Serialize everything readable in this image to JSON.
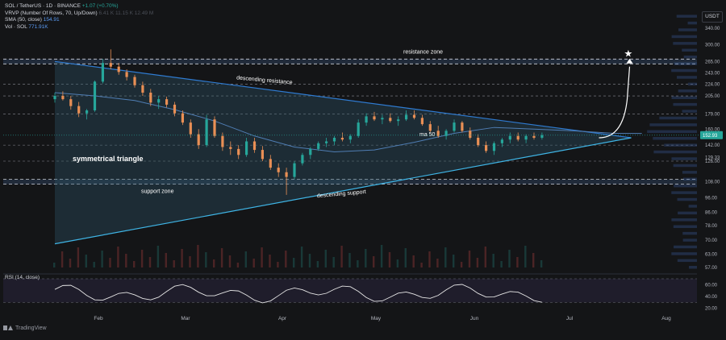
{
  "header": {
    "symbol": "SOL / TetherUS · 1D · BINANCE",
    "change": "+1.07 (+0.70%)",
    "vrvp_label": "VRVP (Number Of Rows, 70, Up/Down)",
    "vrvp_values": "6.41 K   11.15 K   12.49 M",
    "sma_label": "SMA (50, close)",
    "sma_value": "154.91",
    "vol_label": "Vol · SOL",
    "vol_value": "771.91K",
    "currency": "USDT"
  },
  "rsi": {
    "label": "RSI (14, close)",
    "ticks": [
      "60.00",
      "40.00",
      "20.00"
    ]
  },
  "footer": {
    "brand": "TradingView"
  },
  "chart_data": {
    "type": "candlestick",
    "y_scale": "log",
    "ylim": [
      57,
      390
    ],
    "price_ticks": [
      380,
      340,
      300,
      265,
      243,
      224,
      205,
      179,
      160,
      152.93,
      142,
      129.33,
      126,
      108,
      96,
      86,
      78,
      70,
      63,
      57
    ],
    "time_labels": [
      "Feb",
      "Mar",
      "Apr",
      "May",
      "Jun",
      "Jul",
      "Aug"
    ],
    "last_price": 152.93,
    "annotations": {
      "resistance_zone": "resistance zone",
      "support_zone": "support zone",
      "descending_resistance": "descending resistance",
      "descending_support": "descending support",
      "pattern": "symmetrical triangle",
      "ma": "ma 50"
    },
    "levels": {
      "resistance_zone": 265,
      "support_zone": 108,
      "lines": [
        224,
        205,
        179,
        142,
        126
      ]
    },
    "triangle": {
      "upper": [
        [
          0,
          265
        ],
        [
          110,
          150
        ]
      ],
      "lower": [
        [
          0,
          68
        ],
        [
          110,
          150
        ]
      ]
    },
    "sma50": [
      [
        0,
        210
      ],
      [
        10,
        205
      ],
      [
        20,
        198
      ],
      [
        30,
        185
      ],
      [
        40,
        170
      ],
      [
        50,
        152
      ],
      [
        60,
        140
      ],
      [
        70,
        135
      ],
      [
        80,
        137
      ],
      [
        90,
        145
      ],
      [
        100,
        155
      ],
      [
        110,
        162
      ],
      [
        120,
        160
      ],
      [
        130,
        158
      ],
      [
        140,
        155
      ],
      [
        147,
        154.9
      ]
    ],
    "candles": [
      [
        0,
        200,
        210,
        195,
        205
      ],
      [
        2,
        205,
        212,
        198,
        200
      ],
      [
        4,
        200,
        205,
        185,
        190
      ],
      [
        6,
        190,
        196,
        175,
        180
      ],
      [
        8,
        180,
        186,
        172,
        184
      ],
      [
        10,
        184,
        230,
        182,
        228
      ],
      [
        12,
        228,
        270,
        225,
        262
      ],
      [
        14,
        262,
        290,
        250,
        255
      ],
      [
        16,
        255,
        262,
        240,
        245
      ],
      [
        18,
        245,
        250,
        230,
        236
      ],
      [
        20,
        236,
        240,
        218,
        222
      ],
      [
        22,
        222,
        228,
        205,
        210
      ],
      [
        24,
        210,
        216,
        190,
        195
      ],
      [
        26,
        195,
        205,
        186,
        200
      ],
      [
        28,
        200,
        204,
        188,
        192
      ],
      [
        30,
        192,
        196,
        176,
        180
      ],
      [
        32,
        180,
        184,
        165,
        168
      ],
      [
        34,
        168,
        172,
        150,
        154
      ],
      [
        36,
        154,
        160,
        138,
        142
      ],
      [
        38,
        142,
        178,
        140,
        172
      ],
      [
        40,
        172,
        176,
        150,
        152
      ],
      [
        42,
        152,
        156,
        136,
        140
      ],
      [
        44,
        140,
        146,
        132,
        138
      ],
      [
        46,
        138,
        142,
        128,
        132
      ],
      [
        48,
        132,
        150,
        130,
        146
      ],
      [
        50,
        146,
        150,
        134,
        137
      ],
      [
        52,
        137,
        141,
        126,
        128
      ],
      [
        54,
        128,
        132,
        118,
        120
      ],
      [
        56,
        120,
        124,
        112,
        116
      ],
      [
        58,
        116,
        120,
        98,
        112
      ],
      [
        60,
        112,
        126,
        110,
        124
      ],
      [
        62,
        124,
        134,
        122,
        132
      ],
      [
        64,
        132,
        140,
        128,
        138
      ],
      [
        66,
        138,
        146,
        136,
        144
      ],
      [
        68,
        144,
        150,
        140,
        146
      ],
      [
        70,
        146,
        152,
        142,
        150
      ],
      [
        72,
        150,
        156,
        146,
        148
      ],
      [
        74,
        148,
        154,
        144,
        152
      ],
      [
        76,
        152,
        172,
        150,
        168
      ],
      [
        78,
        168,
        180,
        164,
        176
      ],
      [
        80,
        176,
        182,
        170,
        172
      ],
      [
        82,
        172,
        178,
        166,
        174
      ],
      [
        84,
        174,
        180,
        168,
        170
      ],
      [
        86,
        170,
        176,
        164,
        172
      ],
      [
        88,
        172,
        184,
        170,
        178
      ],
      [
        90,
        178,
        184,
        172,
        174
      ],
      [
        92,
        174,
        178,
        164,
        166
      ],
      [
        94,
        166,
        170,
        156,
        158
      ],
      [
        96,
        158,
        164,
        150,
        152
      ],
      [
        98,
        152,
        160,
        148,
        158
      ],
      [
        100,
        158,
        172,
        156,
        168
      ],
      [
        102,
        168,
        170,
        156,
        158
      ],
      [
        104,
        158,
        162,
        148,
        150
      ],
      [
        106,
        150,
        154,
        140,
        142
      ],
      [
        108,
        142,
        146,
        134,
        136
      ],
      [
        110,
        136,
        146,
        132,
        144
      ],
      [
        112,
        144,
        150,
        140,
        148
      ],
      [
        114,
        148,
        156,
        144,
        152
      ],
      [
        116,
        152,
        156,
        146,
        148
      ],
      [
        118,
        148,
        154,
        144,
        152
      ],
      [
        120,
        152,
        156,
        148,
        150
      ],
      [
        122,
        150,
        156,
        148,
        153
      ]
    ]
  }
}
